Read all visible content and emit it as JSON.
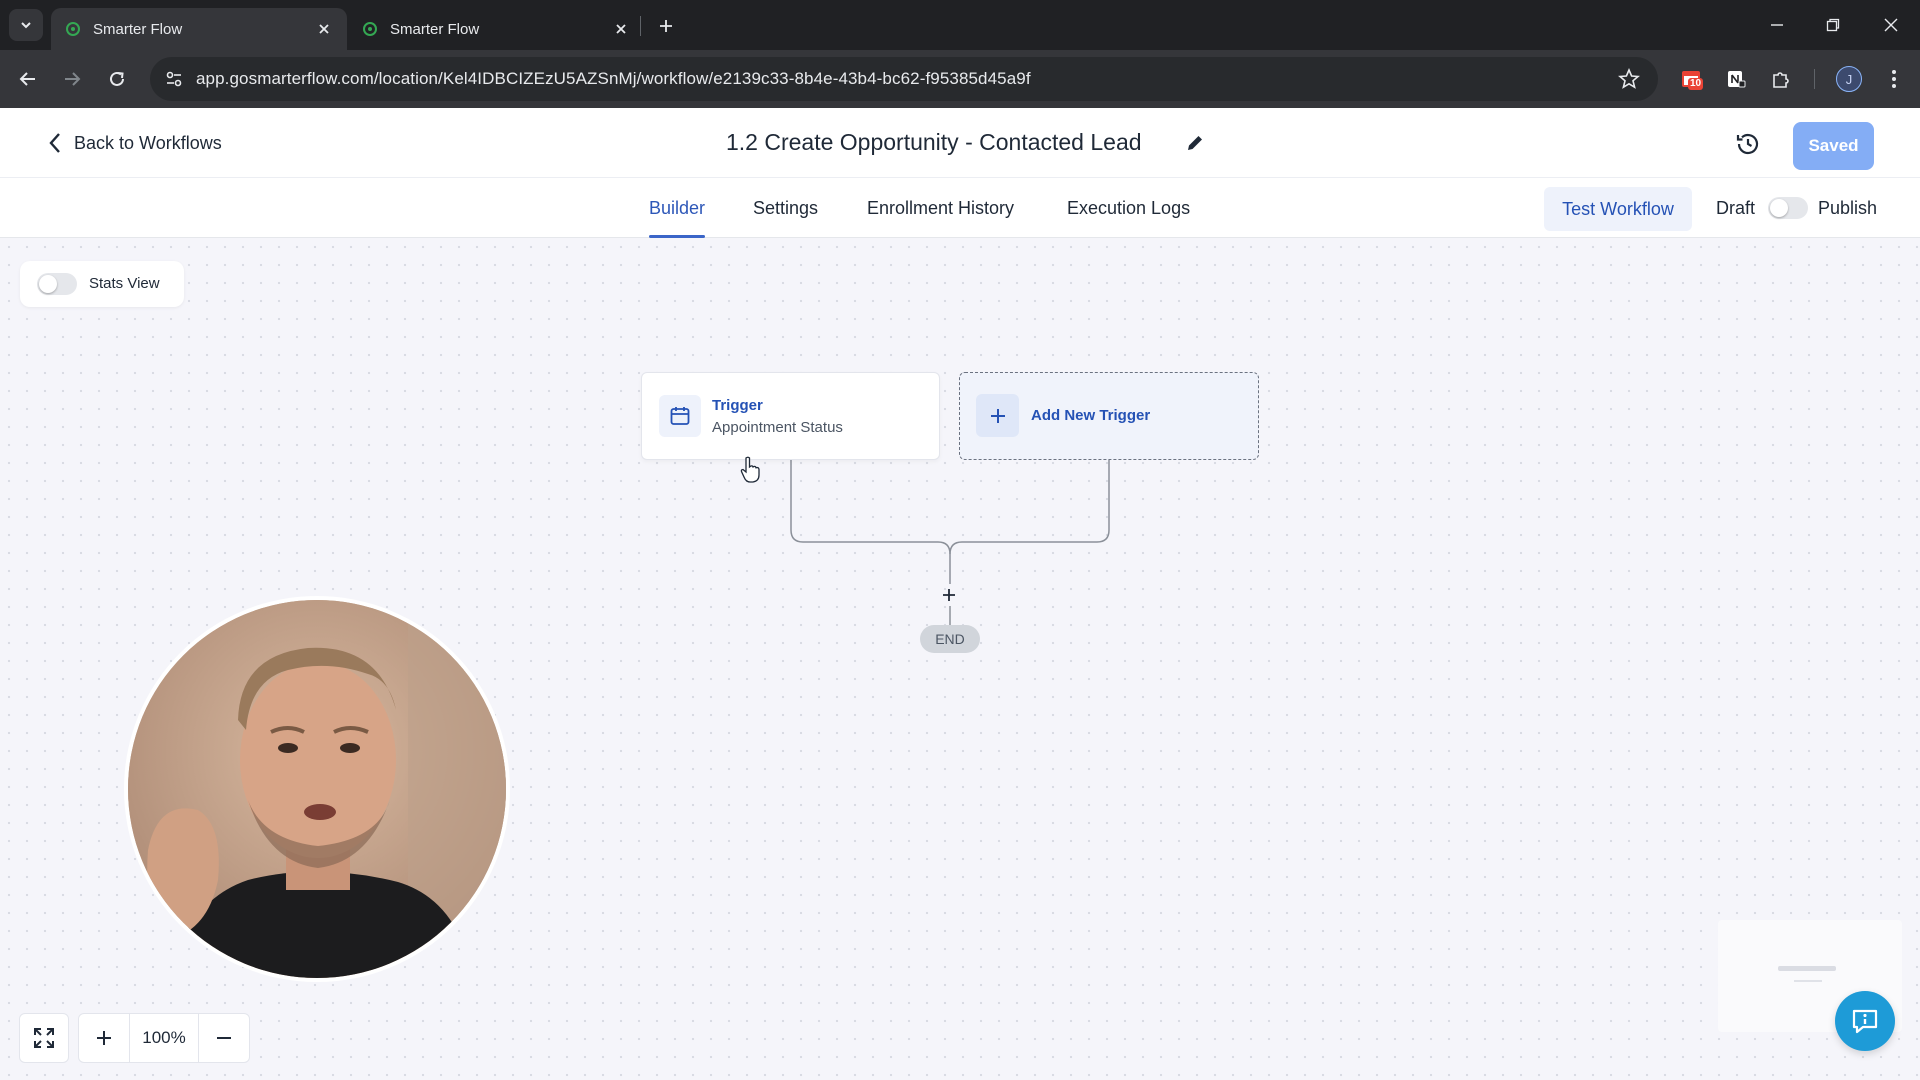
{
  "browser": {
    "tabs": [
      {
        "title": "Smarter Flow",
        "active": true
      },
      {
        "title": "Smarter Flow",
        "active": false
      }
    ],
    "url": "app.gosmarterflow.com/location/Kel4IDBCIZEzU5AZSnMj/workflow/e2139c33-8b4e-43b4-bc62-f95385d45a9f",
    "extension_badge": "10",
    "profile_initial": "J"
  },
  "header": {
    "back_label": "Back to Workflows",
    "workflow_title": "1.2 Create Opportunity - Contacted Lead",
    "saved_label": "Saved"
  },
  "tabs": {
    "items": [
      {
        "label": "Builder",
        "active": true
      },
      {
        "label": "Settings",
        "active": false
      },
      {
        "label": "Enrollment History",
        "active": false
      },
      {
        "label": "Execution Logs",
        "active": false
      }
    ],
    "test_workflow_label": "Test Workflow",
    "draft_label": "Draft",
    "publish_label": "Publish"
  },
  "canvas": {
    "stats_view_label": "Stats View",
    "trigger": {
      "title": "Trigger",
      "subtitle": "Appointment Status"
    },
    "add_trigger_label": "Add New Trigger",
    "end_label": "END",
    "zoom_level": "100%"
  },
  "colors": {
    "accent": "#2552b5",
    "saved_button": "#84adf5",
    "help_button": "#1e9bd7"
  },
  "icons": {
    "back": "chevron-left-icon",
    "edit": "pencil-icon",
    "history": "history-icon",
    "trigger": "calendar-icon",
    "add": "plus-icon",
    "fit": "fullscreen-icon",
    "zoom_in": "plus-icon",
    "zoom_out": "minus-icon",
    "help": "chat-info-icon"
  }
}
